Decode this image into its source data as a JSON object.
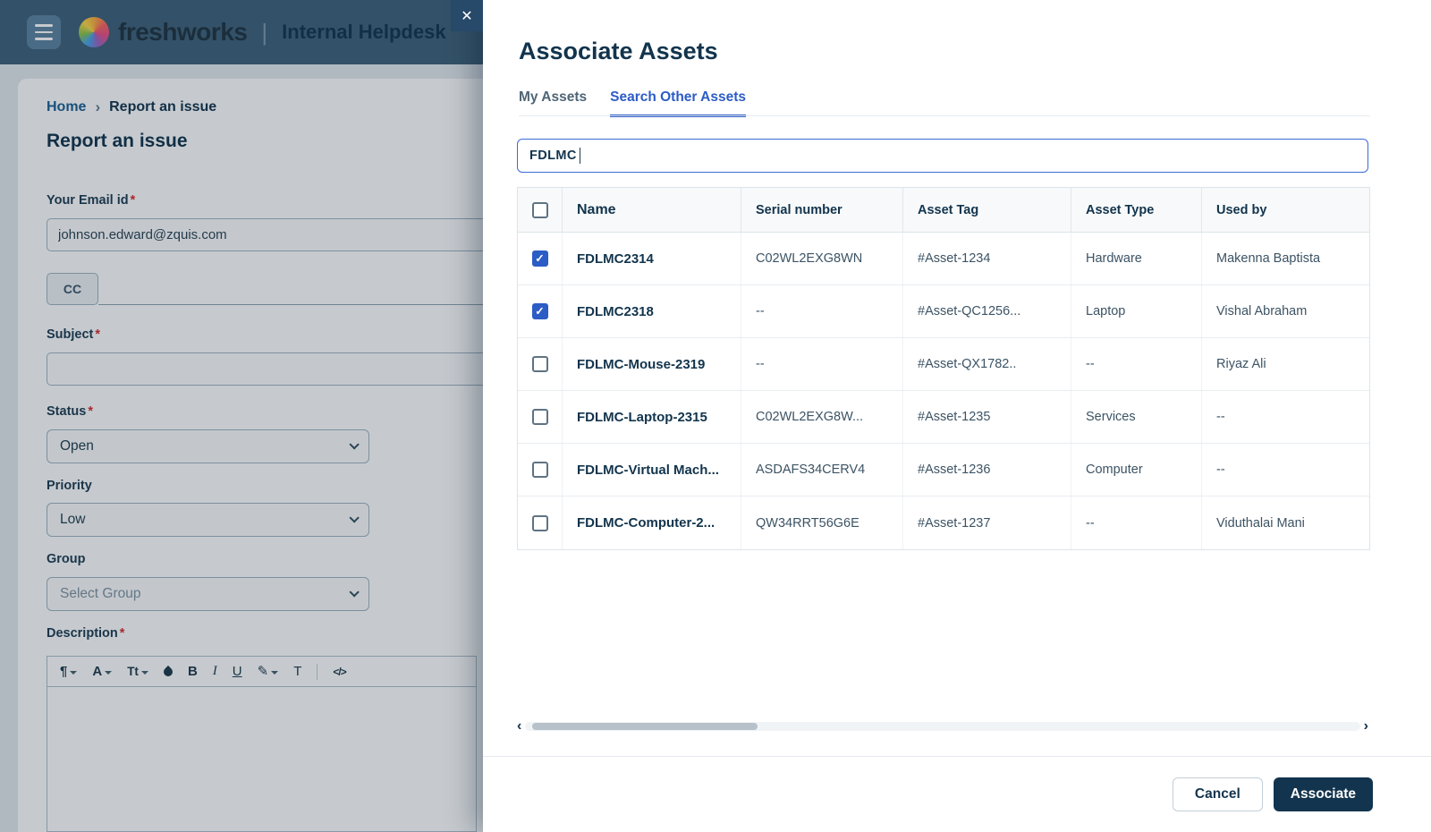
{
  "theme": {
    "accent": "#2c5cc5",
    "navy": "#12344d",
    "danger": "#d72d30",
    "header-bg": "#3f607a"
  },
  "icons": {
    "close": "✕",
    "check": "✓",
    "chevron_left": "‹",
    "chevron_right": "›",
    "breadcrumb_separator": "›"
  },
  "header": {
    "brand": "freshworks",
    "divider": "|",
    "portal_title": "Internal Helpdesk"
  },
  "page": {
    "breadcrumb": {
      "home": "Home",
      "current": "Report an issue"
    },
    "title": "Report an issue",
    "form": {
      "required_marker": "*",
      "email_label": "Your Email id",
      "email_value": "johnson.edward@zquis.com",
      "cc_label": "CC",
      "subject_label": "Subject",
      "status_label": "Status",
      "status_value": "Open",
      "priority_label": "Priority",
      "priority_value": "Low",
      "group_label": "Group",
      "group_placeholder": "Select Group",
      "description_label": "Description",
      "editor_toolbar": {
        "buttons": [
          {
            "name": "paragraph-format",
            "glyph": "¶"
          },
          {
            "name": "font-style",
            "glyph": "A"
          },
          {
            "name": "font-size",
            "glyph": "Tt"
          },
          {
            "name": "text-color",
            "glyph": ""
          },
          {
            "name": "bold",
            "glyph": "B"
          },
          {
            "name": "italic",
            "glyph": "I"
          },
          {
            "name": "underline",
            "glyph": "U"
          },
          {
            "name": "highlight",
            "glyph": "✎"
          },
          {
            "name": "text-format",
            "glyph": "T"
          },
          {
            "name": "insert-code",
            "glyph": "</>"
          }
        ]
      }
    }
  },
  "modal": {
    "title": "Associate Assets",
    "tabs": [
      {
        "label": "My Assets",
        "active": false
      },
      {
        "label": "Search Other Assets",
        "active": true
      }
    ],
    "search_value": "FDLMC",
    "table": {
      "headers": [
        "Name",
        "Serial number",
        "Asset Tag",
        "Asset Type",
        "Used by"
      ],
      "rows": [
        {
          "checked": true,
          "name": "FDLMC2314",
          "serial": "C02WL2EXG8WN",
          "tag": "#Asset-1234",
          "type": "Hardware",
          "used_by": "Makenna Baptista"
        },
        {
          "checked": true,
          "name": "FDLMC2318",
          "serial": "--",
          "tag": "#Asset-QC1256...",
          "type": "Laptop",
          "used_by": "Vishal Abraham"
        },
        {
          "checked": false,
          "name": "FDLMC-Mouse-2319",
          "serial": "--",
          "tag": "#Asset-QX1782..",
          "type": "--",
          "used_by": "Riyaz Ali"
        },
        {
          "checked": false,
          "name": "FDLMC-Laptop-2315",
          "serial": "C02WL2EXG8W...",
          "tag": "#Asset-1235",
          "type": "Services",
          "used_by": "--"
        },
        {
          "checked": false,
          "name": "FDLMC-Virtual Mach...",
          "serial": "ASDAFS34CERV4",
          "tag": "#Asset-1236",
          "type": "Computer",
          "used_by": "--"
        },
        {
          "checked": false,
          "name": "FDLMC-Computer-2...",
          "serial": "QW34RRT56G6E",
          "tag": "#Asset-1237",
          "type": "--",
          "used_by": "Viduthalai Mani"
        }
      ]
    },
    "footer": {
      "cancel_label": "Cancel",
      "associate_label": "Associate"
    }
  }
}
